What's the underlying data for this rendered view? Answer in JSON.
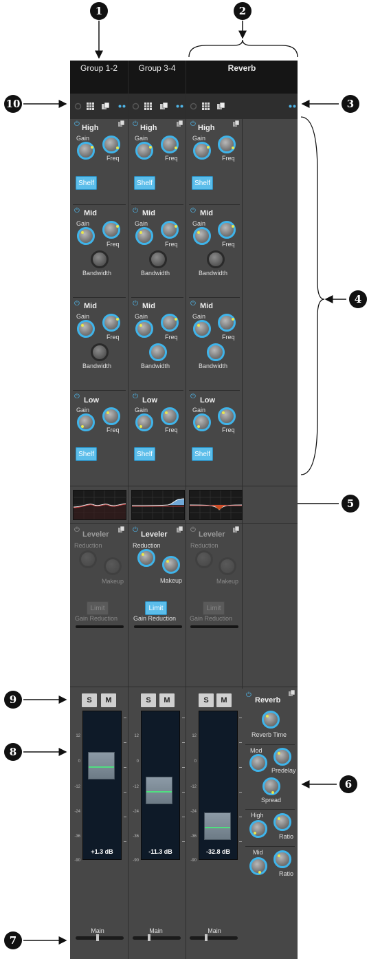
{
  "callouts": [
    "1",
    "2",
    "3",
    "4",
    "5",
    "6",
    "7",
    "8",
    "9",
    "10"
  ],
  "channels": [
    {
      "name": "Group 1-2",
      "eq_bands": [
        {
          "title": "High",
          "gain": "Gain",
          "freq": "Freq",
          "button": "Shelf"
        },
        {
          "title": "Mid",
          "gain": "Gain",
          "freq": "Freq",
          "bandwidth": "Bandwidth"
        },
        {
          "title": "Mid",
          "gain": "Gain",
          "freq": "Freq",
          "bandwidth": "Bandwidth"
        },
        {
          "title": "Low",
          "gain": "Gain",
          "freq": "Freq",
          "button": "Shelf"
        }
      ],
      "leveler": {
        "title": "Leveler",
        "reduction": "Reduction",
        "makeup": "Makeup",
        "limit": "Limit",
        "gain_reduction": "Gain Reduction",
        "enabled": false
      },
      "solo": "S",
      "mute": "M",
      "db": "+1.3 dB",
      "output": "Main"
    },
    {
      "name": "Group 3-4",
      "eq_bands": [
        {
          "title": "High",
          "gain": "Gain",
          "freq": "Freq",
          "button": "Shelf"
        },
        {
          "title": "Mid",
          "gain": "Gain",
          "freq": "Freq",
          "bandwidth": "Bandwidth"
        },
        {
          "title": "Mid",
          "gain": "Gain",
          "freq": "Freq",
          "bandwidth": "Bandwidth"
        },
        {
          "title": "Low",
          "gain": "Gain",
          "freq": "Freq",
          "button": "Shelf"
        }
      ],
      "leveler": {
        "title": "Leveler",
        "reduction": "Reduction",
        "makeup": "Makeup",
        "limit": "Limit",
        "gain_reduction": "Gain Reduction",
        "enabled": true
      },
      "solo": "S",
      "mute": "M",
      "db": "-11.3 dB",
      "output": "Main"
    },
    {
      "name": "Reverb",
      "eq_bands": [
        {
          "title": "High",
          "gain": "Gain",
          "freq": "Freq",
          "button": "Shelf"
        },
        {
          "title": "Mid",
          "gain": "Gain",
          "freq": "Freq",
          "bandwidth": "Bandwidth"
        },
        {
          "title": "Mid",
          "gain": "Gain",
          "freq": "Freq",
          "bandwidth": "Bandwidth"
        },
        {
          "title": "Low",
          "gain": "Gain",
          "freq": "Freq",
          "button": "Shelf"
        }
      ],
      "leveler": {
        "title": "Leveler",
        "reduction": "Reduction",
        "makeup": "Makeup",
        "limit": "Limit",
        "gain_reduction": "Gain Reduction",
        "enabled": false
      },
      "solo": "S",
      "mute": "M",
      "db": "-32.8 dB",
      "output": "Main"
    }
  ],
  "fader_scale": [
    "12",
    "0",
    "-12",
    "-24",
    "-36",
    "-90"
  ],
  "reverb_panel": {
    "title": "Reverb",
    "reverb_time": "Reverb Time",
    "mod": "Mod",
    "predelay": "Predelay",
    "spread": "Spread",
    "high": "High",
    "high_ratio": "Ratio",
    "mid": "Mid",
    "mid_ratio": "Ratio"
  },
  "colors": {
    "accent": "#4fb4e6",
    "panel": "#474747",
    "header": "#151515",
    "button_on": "#5bbdea"
  }
}
